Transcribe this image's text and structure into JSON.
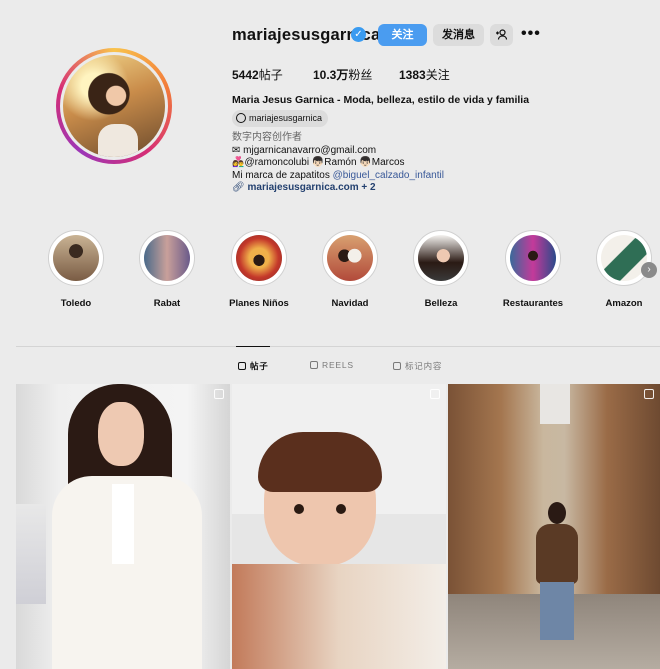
{
  "profile": {
    "username": "mariajesusgarnica",
    "follow_label": "关注",
    "message_label": "发消息",
    "posts_count": "5442",
    "posts_label": "帖子",
    "followers_count": "10.3万",
    "followers_label": "粉丝",
    "following_count": "1383",
    "following_label": "关注",
    "full_name": "Maria Jesus Garnica - Moda, belleza, estilo de vida y familia",
    "threads_handle": "mariajesusgarnica",
    "category": "数字内容创作者",
    "bio_email": "✉ mjgarnicanavarro@gmail.com",
    "bio_family": "👩‍❤️‍👨@ramoncolubi 👦🏻Ramón 👦🏻Marcos",
    "bio_shoes_prefix": "Mi marca de zapatitos ",
    "bio_shoes_mention": "@biguel_calzado_infantil",
    "link": "mariajesusgarnica.com + 2"
  },
  "highlights": [
    {
      "label": "Toledo",
      "color": "#9a7a5e"
    },
    {
      "label": "Rabat",
      "color": "#8a6e9a"
    },
    {
      "label": "Planes Niños",
      "color": "#c48a3a"
    },
    {
      "label": "Navidad",
      "color": "#b24a3a"
    },
    {
      "label": "Belleza",
      "color": "#3a3a3a"
    },
    {
      "label": "Restaurantes",
      "color": "#8a3a8a"
    },
    {
      "label": "Amazon",
      "color": "#2f6e55"
    }
  ],
  "tabs": {
    "posts": "帖子",
    "reels": "REELS",
    "tagged": "标记内容"
  },
  "colors": {
    "accent": "#4a9cf0",
    "background": "#ebebeb"
  }
}
